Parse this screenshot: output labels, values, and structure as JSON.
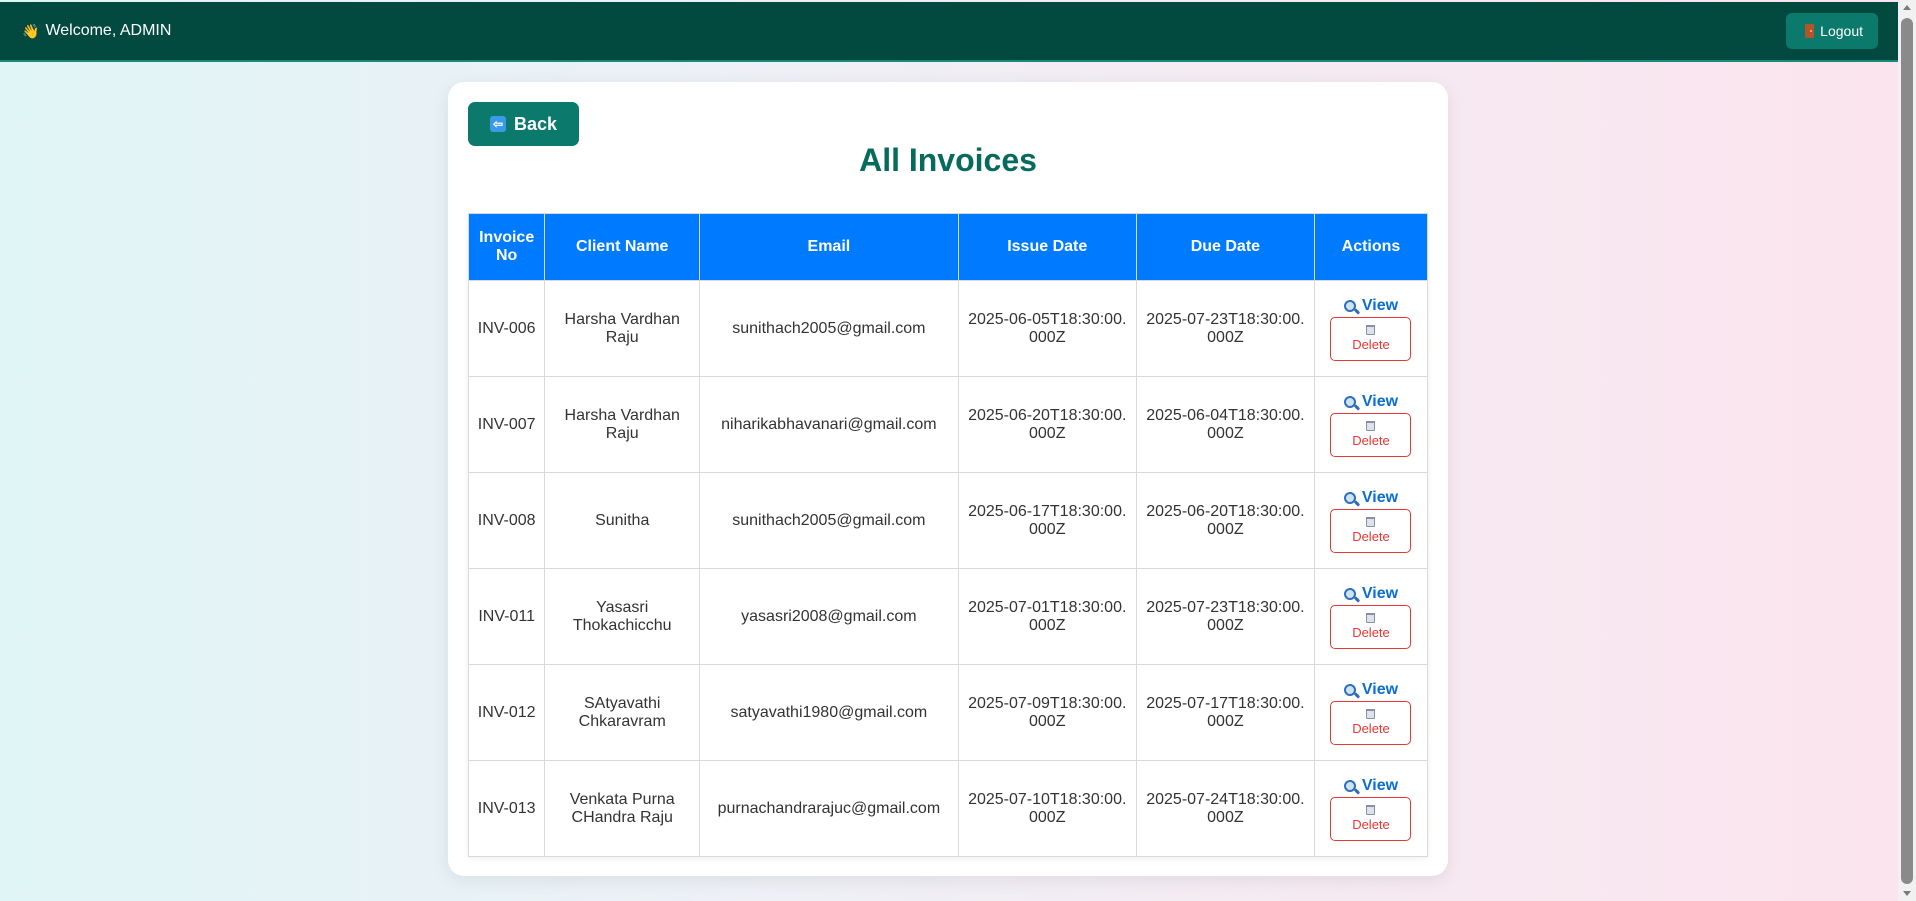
{
  "header": {
    "welcome_text": "Welcome, ADMIN",
    "logout_label": "Logout"
  },
  "page": {
    "back_label": "Back",
    "title": "All Invoices"
  },
  "table": {
    "columns": [
      "Invoice No",
      "Client Name",
      "Email",
      "Issue Date",
      "Due Date",
      "Actions"
    ],
    "view_label": "View",
    "delete_label": "Delete",
    "rows": [
      {
        "invoice_no": "INV-006",
        "client_name": "Harsha Vardhan Raju",
        "email": "sunithach2005@gmail.com",
        "issue_date": "2025-06-05T18:30:00.000Z",
        "due_date": "2025-07-23T18:30:00.000Z"
      },
      {
        "invoice_no": "INV-007",
        "client_name": "Harsha Vardhan Raju",
        "email": "niharikabhavanari@gmail.com",
        "issue_date": "2025-06-20T18:30:00.000Z",
        "due_date": "2025-06-04T18:30:00.000Z"
      },
      {
        "invoice_no": "INV-008",
        "client_name": "Sunitha",
        "email": "sunithach2005@gmail.com",
        "issue_date": "2025-06-17T18:30:00.000Z",
        "due_date": "2025-06-20T18:30:00.000Z"
      },
      {
        "invoice_no": "INV-011",
        "client_name": "Yasasri Thokachicchu",
        "email": "yasasri2008@gmail.com",
        "issue_date": "2025-07-01T18:30:00.000Z",
        "due_date": "2025-07-23T18:30:00.000Z"
      },
      {
        "invoice_no": "INV-012",
        "client_name": "SAtyavathi Chkaravram",
        "email": "satyavathi1980@gmail.com",
        "issue_date": "2025-07-09T18:30:00.000Z",
        "due_date": "2025-07-17T18:30:00.000Z"
      },
      {
        "invoice_no": "INV-013",
        "client_name": "Venkata Purna CHandra Raju",
        "email": "purnachandrarajuc@gmail.com",
        "issue_date": "2025-07-10T18:30:00.000Z",
        "due_date": "2025-07-24T18:30:00.000Z"
      }
    ]
  },
  "icons": {
    "welcome": "waving-hand-icon",
    "logout": "door-icon",
    "back": "back-arrow-icon",
    "view": "magnifier-icon",
    "delete": "trash-icon"
  },
  "colors": {
    "topbar": "#024a40",
    "accent": "#0b7a6c",
    "title": "#066a5c",
    "table_header": "#007bff",
    "view_link": "#0a6ed8",
    "delete": "#e53935"
  }
}
